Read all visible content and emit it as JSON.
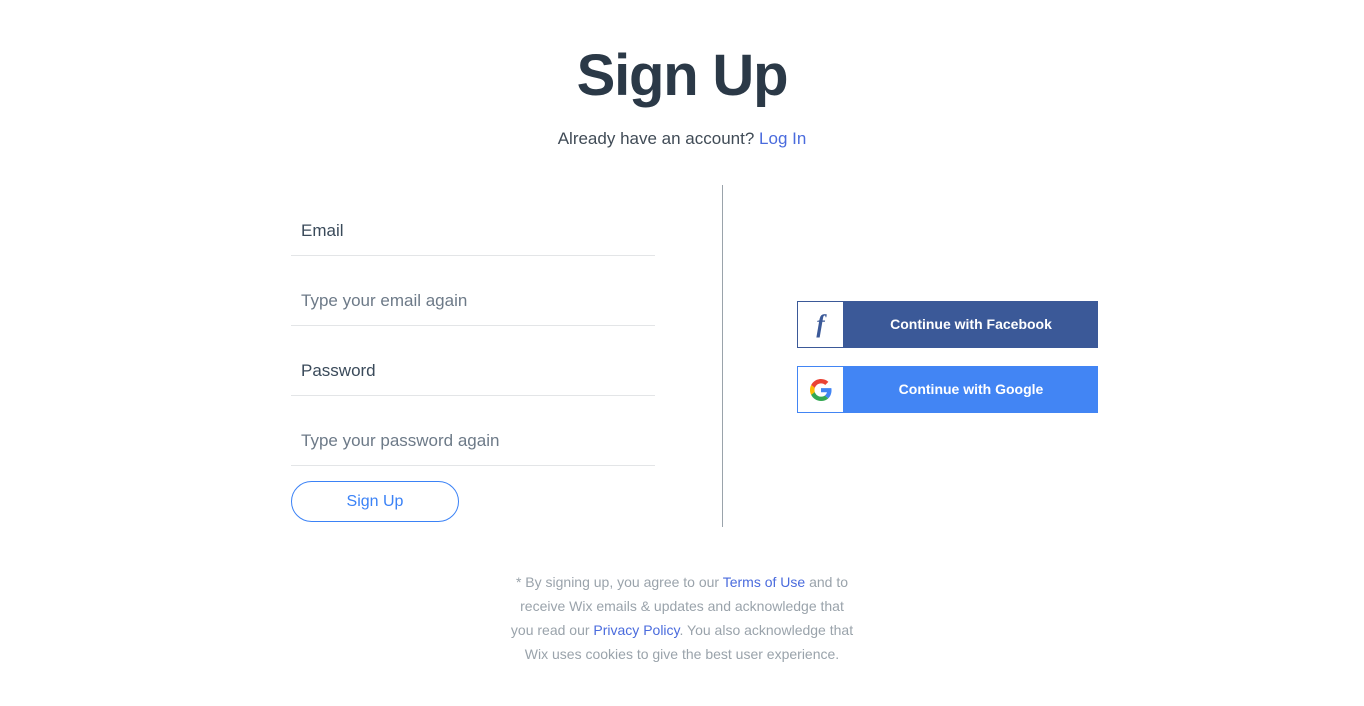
{
  "header": {
    "title": "Sign Up",
    "subtitle_prefix": "Already have an account?",
    "login_link": "Log In"
  },
  "form": {
    "fields": [
      {
        "name": "email",
        "placeholder": "Email",
        "value": "",
        "emphasis": "strong"
      },
      {
        "name": "email-confirm",
        "placeholder": "Type your email again",
        "value": "",
        "emphasis": "normal"
      },
      {
        "name": "password",
        "placeholder": "Password",
        "value": "",
        "emphasis": "strong"
      },
      {
        "name": "password-confirm",
        "placeholder": "Type your password again",
        "value": "",
        "emphasis": "normal"
      }
    ],
    "submit_label": "Sign Up"
  },
  "social": {
    "facebook": {
      "label": "Continue with Facebook",
      "icon": "facebook-icon",
      "glyph": "f",
      "color": "#3b5998"
    },
    "google": {
      "label": "Continue with Google",
      "icon": "google-icon",
      "color": "#4285f4"
    }
  },
  "footer": {
    "line1_a": "* By signing up, you agree to our ",
    "line1_link": "Terms of Use",
    "line1_b": " and to",
    "line2": "receive Wix emails & updates and acknowledge that",
    "line3_a": "you read our ",
    "line3_link": "Privacy Policy",
    "line3_b": ". You also acknowledge that",
    "line4": "Wix uses cookies to give the best user experience."
  },
  "colors": {
    "title": "#2b3947",
    "link": "#4a6bdd",
    "accent": "#3b82f6",
    "facebook": "#3b5998",
    "google": "#4285f4",
    "muted_text": "#9aa3ab",
    "field_underline": "#e3e5e7",
    "divider": "#9aa3ab"
  }
}
